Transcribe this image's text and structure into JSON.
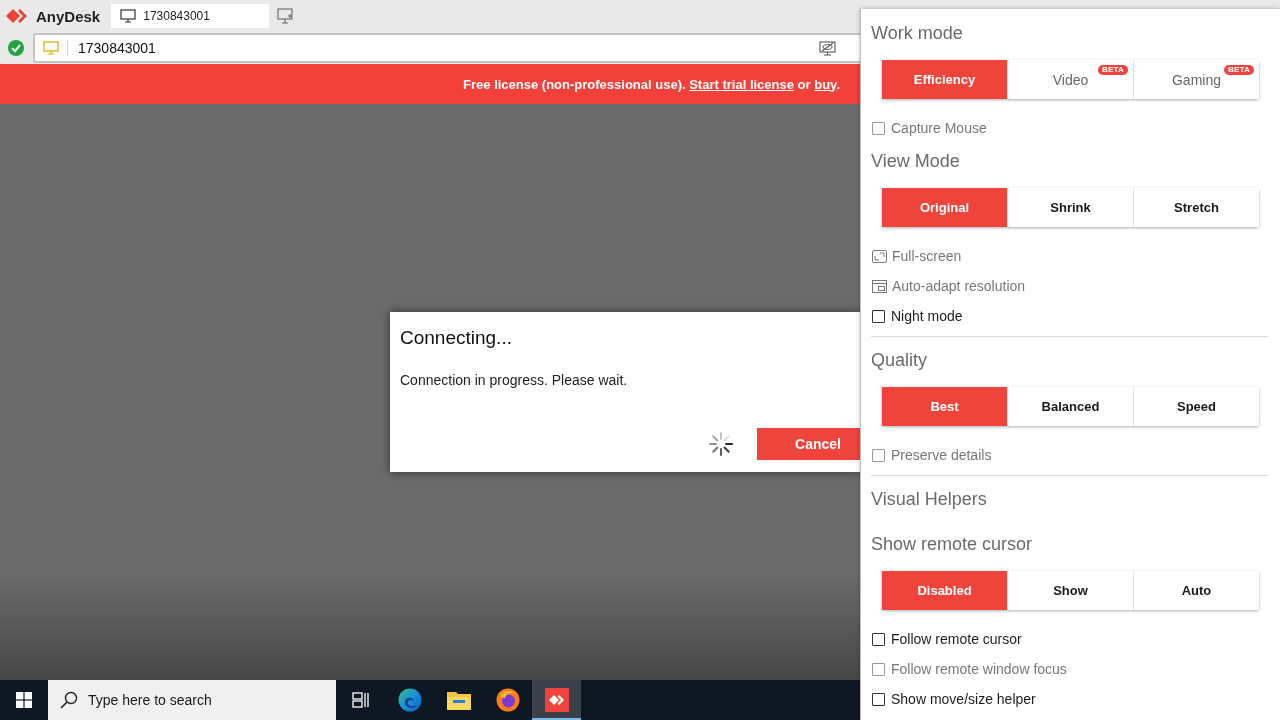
{
  "app": {
    "name": "AnyDesk"
  },
  "tabs": [
    {
      "label": "1730843001",
      "selected": true
    }
  ],
  "address_bar": {
    "value": "1730843001"
  },
  "license_banner": {
    "parts": [
      {
        "kind": "text",
        "text": "Free license (non-professional use). "
      },
      {
        "kind": "link",
        "text": "Start trial license"
      },
      {
        "kind": "text",
        "text": " or "
      },
      {
        "kind": "link",
        "text": "buy"
      },
      {
        "kind": "text",
        "text": "."
      }
    ]
  },
  "dialog": {
    "title": "Connecting...",
    "message": "Connection in progress. Please wait.",
    "busy": true,
    "buttons": [
      "Cancel"
    ]
  },
  "taskbar": {
    "search": {
      "placeholder": "Type here to search"
    },
    "apps": [
      {
        "selected": false
      },
      {
        "selected": false
      },
      {
        "selected": false
      },
      {
        "selected": false
      },
      {
        "selected": true
      }
    ]
  },
  "settings_panel": {
    "sections": [
      {
        "title": "Work mode",
        "separated": false,
        "options": [
          {
            "label": "Efficiency",
            "selected": true,
            "disabled": false
          },
          {
            "label": "Video",
            "selected": false,
            "disabled": true,
            "badge": "BETA"
          },
          {
            "label": "Gaming",
            "selected": false,
            "disabled": true,
            "badge": "BETA"
          }
        ],
        "items": [
          {
            "kind": "checkbox",
            "label": "Capture Mouse",
            "checked": false,
            "disabled": true
          }
        ]
      },
      {
        "title": "View Mode",
        "separated": false,
        "options": [
          {
            "label": "Original",
            "selected": true,
            "disabled": false
          },
          {
            "label": "Shrink",
            "selected": false,
            "disabled": false
          },
          {
            "label": "Stretch",
            "selected": false,
            "disabled": false
          }
        ],
        "items": [
          {
            "kind": "fullscreen",
            "label": "Full-screen",
            "disabled": true
          },
          {
            "kind": "resolution",
            "label": "Auto-adapt resolution",
            "disabled": true
          },
          {
            "kind": "checkbox",
            "label": "Night mode",
            "checked": false,
            "disabled": false
          }
        ]
      },
      {
        "title": "Quality",
        "separated": true,
        "options": [
          {
            "label": "Best",
            "selected": true,
            "disabled": false
          },
          {
            "label": "Balanced",
            "selected": false,
            "disabled": false
          },
          {
            "label": "Speed",
            "selected": false,
            "disabled": false
          }
        ],
        "items": [
          {
            "kind": "checkbox",
            "label": "Preserve details",
            "checked": false,
            "disabled": true
          }
        ]
      },
      {
        "title": "Visual Helpers",
        "separated": true
      },
      {
        "title": "Show remote cursor",
        "separated": false,
        "options": [
          {
            "label": "Disabled",
            "selected": true,
            "disabled": false
          },
          {
            "label": "Show",
            "selected": false,
            "disabled": false
          },
          {
            "label": "Auto",
            "selected": false,
            "disabled": false
          }
        ],
        "items": [
          {
            "kind": "checkbox",
            "label": "Follow remote cursor",
            "checked": false,
            "disabled": false
          },
          {
            "kind": "checkbox",
            "label": "Follow remote window focus",
            "checked": false,
            "disabled": true
          },
          {
            "kind": "checkbox",
            "label": "Show move/size helper",
            "checked": false,
            "disabled": false
          }
        ]
      }
    ]
  }
}
